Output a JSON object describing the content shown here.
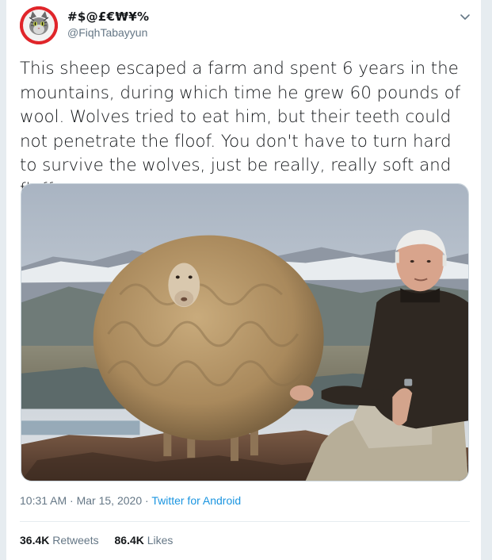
{
  "author": {
    "display_name": "#$@£€₩¥%",
    "handle": "@FiqhTabayyun"
  },
  "tweet": {
    "text": "This sheep escaped a farm and spent 6 years in the mountains, during which time he grew 60 pounds of wool. Wolves tried to eat him, but their teeth could not penetrate the floof. You don't have to turn hard to survive the wolves, just be really, really soft and fluffy."
  },
  "meta": {
    "time": "10:31 AM",
    "separator": " · ",
    "date": "Mar 15, 2020",
    "source": "Twitter for Android"
  },
  "stats": {
    "retweets_count": "36.4K",
    "retweets_label": "Retweets",
    "likes_count": "86.4K",
    "likes_label": "Likes"
  },
  "icons": {
    "menu": "chevron-down-icon",
    "avatar": "cat-avatar"
  },
  "colors": {
    "link": "#1b95e0",
    "secondary_text": "#657786",
    "avatar_bg": "#e0252a"
  }
}
